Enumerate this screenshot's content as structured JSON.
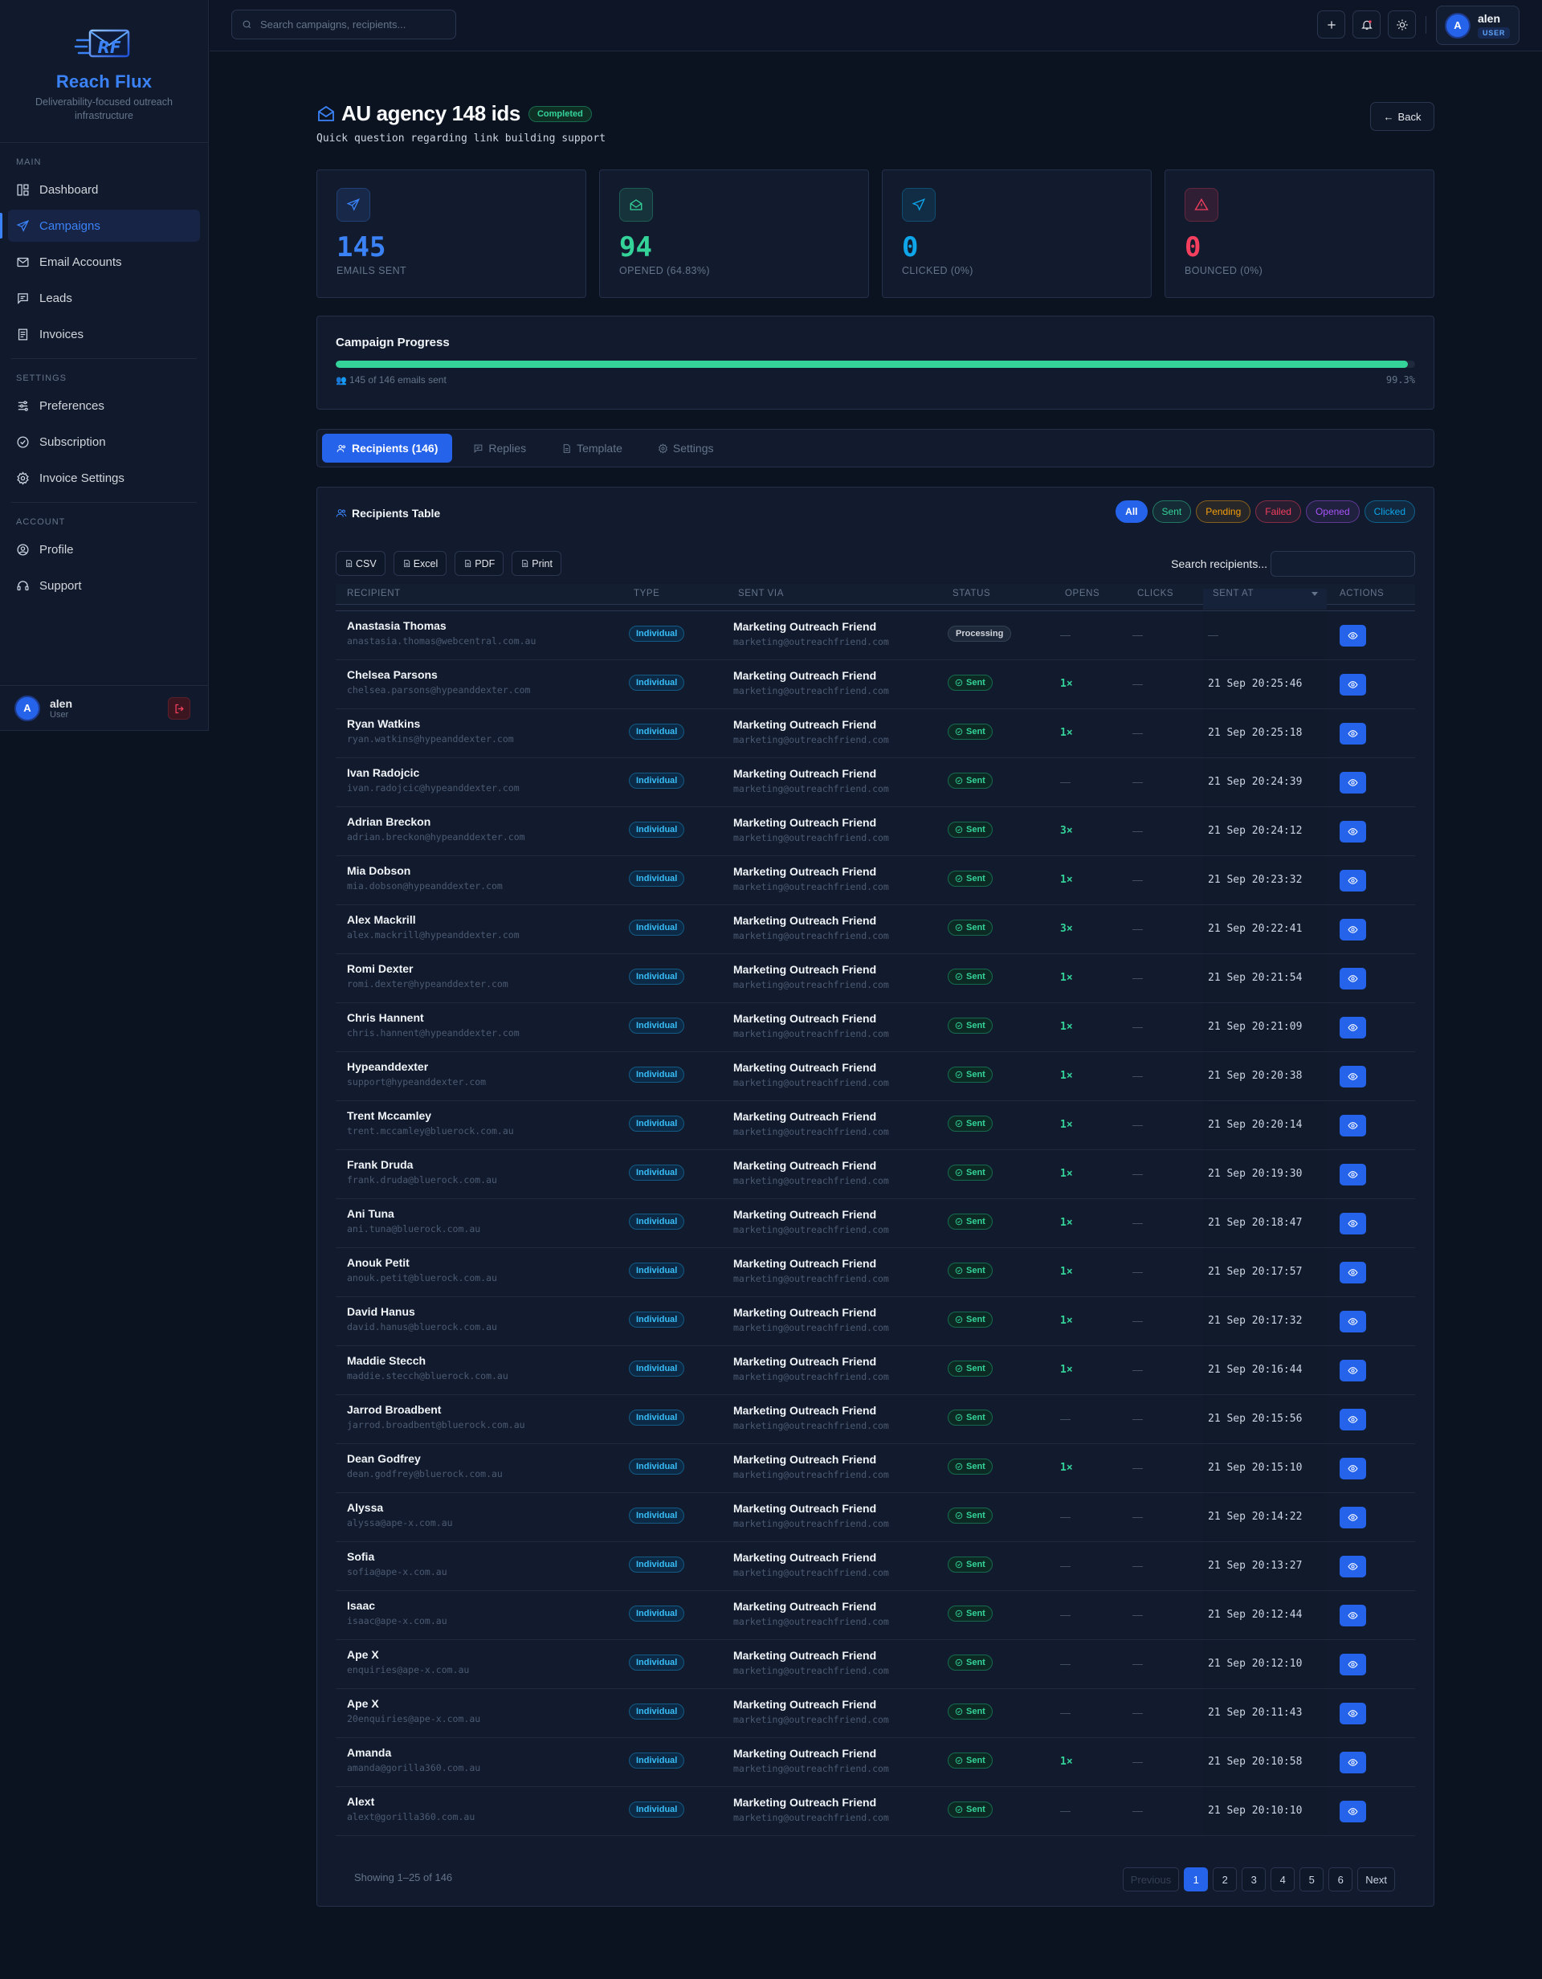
{
  "brand": {
    "name": "Reach Flux",
    "tagline": "Deliverability-focused outreach infrastructure"
  },
  "sidebar": {
    "sections": [
      {
        "title": "Main",
        "items": [
          {
            "label": "Dashboard",
            "icon": "dashboard-icon"
          },
          {
            "label": "Campaigns",
            "icon": "send-icon",
            "active": true
          },
          {
            "label": "Email Accounts",
            "icon": "mail-icon"
          },
          {
            "label": "Leads",
            "icon": "message-icon"
          },
          {
            "label": "Invoices",
            "icon": "receipt-icon"
          }
        ]
      },
      {
        "title": "Settings",
        "items": [
          {
            "label": "Preferences",
            "icon": "sliders-icon"
          },
          {
            "label": "Subscription",
            "icon": "badge-check-icon"
          },
          {
            "label": "Invoice Settings",
            "icon": "gear-icon"
          }
        ]
      },
      {
        "title": "Account",
        "items": [
          {
            "label": "Profile",
            "icon": "user-circle-icon"
          },
          {
            "label": "Support",
            "icon": "headset-icon"
          }
        ]
      }
    ],
    "user": {
      "initial": "A",
      "name": "alen",
      "role": "User"
    }
  },
  "topbar": {
    "search_placeholder": "Search campaigns, recipients...",
    "user": {
      "initial": "A",
      "name": "alen",
      "role": "USER"
    }
  },
  "campaign": {
    "title": "AU agency 148 ids",
    "status": "Completed",
    "subject": "Quick question regarding link building support",
    "back_label": "Back"
  },
  "stats": [
    {
      "value": "145",
      "label": "Emails Sent",
      "color": "#3b82f6",
      "icon": "send-icon"
    },
    {
      "value": "94",
      "label": "Opened (64.83%)",
      "color": "#34d399",
      "icon": "mail-open-icon"
    },
    {
      "value": "0",
      "label": "Clicked (0%)",
      "color": "#0ea5e9",
      "icon": "cursor-icon"
    },
    {
      "value": "0",
      "label": "Bounced (0%)",
      "color": "#f43f5e",
      "icon": "warning-icon"
    }
  ],
  "progress": {
    "title": "Campaign Progress",
    "summary": "145 of 146 emails sent",
    "percent_label": "99.3%",
    "fraction": 0.993
  },
  "tabs": [
    {
      "label": "Recipients (146)",
      "active": true,
      "icon": "users-icon"
    },
    {
      "label": "Replies",
      "icon": "message-icon"
    },
    {
      "label": "Template",
      "icon": "file-icon"
    },
    {
      "label": "Settings",
      "icon": "gear-icon"
    }
  ],
  "table": {
    "title": "Recipients Table",
    "filters": [
      {
        "label": "All",
        "color": "#2563eb",
        "active": true
      },
      {
        "label": "Sent",
        "color": "#34d399"
      },
      {
        "label": "Pending",
        "color": "#f59e0b"
      },
      {
        "label": "Failed",
        "color": "#f43f5e"
      },
      {
        "label": "Opened",
        "color": "#a855f7"
      },
      {
        "label": "Clicked",
        "color": "#0ea5e9"
      }
    ],
    "exports": [
      "CSV",
      "Excel",
      "PDF",
      "Print"
    ],
    "search_label": "Search recipients...",
    "columns": [
      "Recipient",
      "Type",
      "Sent Via",
      "Status",
      "Opens",
      "Clicks",
      "Sent At",
      "Actions"
    ],
    "via_name": "Marketing Outreach Friend",
    "via_email": "marketing@outreachfriend.com",
    "type_label": "Individual",
    "rows": [
      {
        "name": "Anastasia Thomas",
        "email": "anastasia.thomas@webcentral.com.au",
        "status": "Processing",
        "opens": "—",
        "clicks": "—",
        "sent_at": "—"
      },
      {
        "name": "Chelsea Parsons",
        "email": "chelsea.parsons@hypeanddexter.com",
        "status": "Sent",
        "opens": "1×",
        "clicks": "—",
        "sent_at": "21 Sep 20:25:46"
      },
      {
        "name": "Ryan Watkins",
        "email": "ryan.watkins@hypeanddexter.com",
        "status": "Sent",
        "opens": "1×",
        "clicks": "—",
        "sent_at": "21 Sep 20:25:18"
      },
      {
        "name": "Ivan Radojcic",
        "email": "ivan.radojcic@hypeanddexter.com",
        "status": "Sent",
        "opens": "—",
        "clicks": "—",
        "sent_at": "21 Sep 20:24:39"
      },
      {
        "name": "Adrian Breckon",
        "email": "adrian.breckon@hypeanddexter.com",
        "status": "Sent",
        "opens": "3×",
        "clicks": "—",
        "sent_at": "21 Sep 20:24:12"
      },
      {
        "name": "Mia Dobson",
        "email": "mia.dobson@hypeanddexter.com",
        "status": "Sent",
        "opens": "1×",
        "clicks": "—",
        "sent_at": "21 Sep 20:23:32"
      },
      {
        "name": "Alex Mackrill",
        "email": "alex.mackrill@hypeanddexter.com",
        "status": "Sent",
        "opens": "3×",
        "clicks": "—",
        "sent_at": "21 Sep 20:22:41"
      },
      {
        "name": "Romi Dexter",
        "email": "romi.dexter@hypeanddexter.com",
        "status": "Sent",
        "opens": "1×",
        "clicks": "—",
        "sent_at": "21 Sep 20:21:54"
      },
      {
        "name": "Chris Hannent",
        "email": "chris.hannent@hypeanddexter.com",
        "status": "Sent",
        "opens": "1×",
        "clicks": "—",
        "sent_at": "21 Sep 20:21:09"
      },
      {
        "name": "Hypeanddexter",
        "email": "support@hypeanddexter.com",
        "status": "Sent",
        "opens": "1×",
        "clicks": "—",
        "sent_at": "21 Sep 20:20:38"
      },
      {
        "name": "Trent Mccamley",
        "email": "trent.mccamley@bluerock.com.au",
        "status": "Sent",
        "opens": "1×",
        "clicks": "—",
        "sent_at": "21 Sep 20:20:14"
      },
      {
        "name": "Frank Druda",
        "email": "frank.druda@bluerock.com.au",
        "status": "Sent",
        "opens": "1×",
        "clicks": "—",
        "sent_at": "21 Sep 20:19:30"
      },
      {
        "name": "Ani Tuna",
        "email": "ani.tuna@bluerock.com.au",
        "status": "Sent",
        "opens": "1×",
        "clicks": "—",
        "sent_at": "21 Sep 20:18:47"
      },
      {
        "name": "Anouk Petit",
        "email": "anouk.petit@bluerock.com.au",
        "status": "Sent",
        "opens": "1×",
        "clicks": "—",
        "sent_at": "21 Sep 20:17:57"
      },
      {
        "name": "David Hanus",
        "email": "david.hanus@bluerock.com.au",
        "status": "Sent",
        "opens": "1×",
        "clicks": "—",
        "sent_at": "21 Sep 20:17:32"
      },
      {
        "name": "Maddie Stecch",
        "email": "maddie.stecch@bluerock.com.au",
        "status": "Sent",
        "opens": "1×",
        "clicks": "—",
        "sent_at": "21 Sep 20:16:44"
      },
      {
        "name": "Jarrod Broadbent",
        "email": "jarrod.broadbent@bluerock.com.au",
        "status": "Sent",
        "opens": "—",
        "clicks": "—",
        "sent_at": "21 Sep 20:15:56"
      },
      {
        "name": "Dean Godfrey",
        "email": "dean.godfrey@bluerock.com.au",
        "status": "Sent",
        "opens": "1×",
        "clicks": "—",
        "sent_at": "21 Sep 20:15:10"
      },
      {
        "name": "Alyssa",
        "email": "alyssa@ape-x.com.au",
        "status": "Sent",
        "opens": "—",
        "clicks": "—",
        "sent_at": "21 Sep 20:14:22"
      },
      {
        "name": "Sofia",
        "email": "sofia@ape-x.com.au",
        "status": "Sent",
        "opens": "—",
        "clicks": "—",
        "sent_at": "21 Sep 20:13:27"
      },
      {
        "name": "Isaac",
        "email": "isaac@ape-x.com.au",
        "status": "Sent",
        "opens": "—",
        "clicks": "—",
        "sent_at": "21 Sep 20:12:44"
      },
      {
        "name": "Ape X",
        "email": "enquiries@ape-x.com.au",
        "status": "Sent",
        "opens": "—",
        "clicks": "—",
        "sent_at": "21 Sep 20:12:10"
      },
      {
        "name": "Ape X",
        "email": "20enquiries@ape-x.com.au",
        "status": "Sent",
        "opens": "—",
        "clicks": "—",
        "sent_at": "21 Sep 20:11:43"
      },
      {
        "name": "Amanda",
        "email": "amanda@gorilla360.com.au",
        "status": "Sent",
        "opens": "1×",
        "clicks": "—",
        "sent_at": "21 Sep 20:10:58"
      },
      {
        "name": "Alext",
        "email": "alext@gorilla360.com.au",
        "status": "Sent",
        "opens": "—",
        "clicks": "—",
        "sent_at": "21 Sep 20:10:10"
      }
    ]
  },
  "pagination": {
    "info": "Showing 1–25 of 146",
    "previous": "Previous",
    "next": "Next",
    "pages": [
      "1",
      "2",
      "3",
      "4",
      "5",
      "6"
    ],
    "current": "1"
  }
}
